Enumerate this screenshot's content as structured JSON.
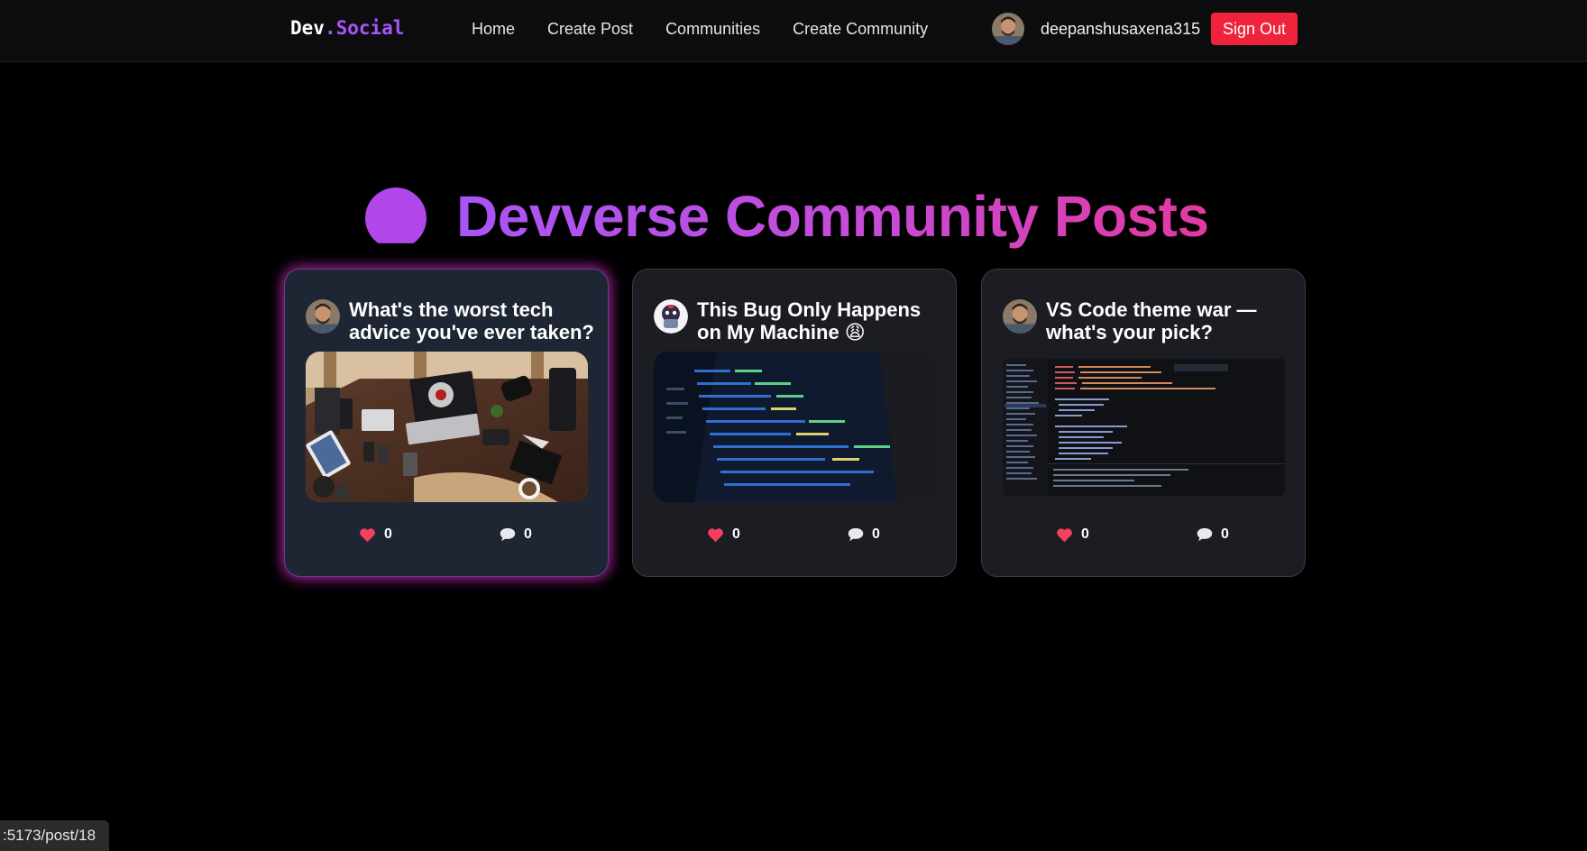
{
  "navbar": {
    "brand_part1": "Dev",
    "brand_part2": ".Social",
    "links": [
      "Home",
      "Create Post",
      "Communities",
      "Create Community"
    ],
    "username": "deepanshusaxena315",
    "signout_label": "Sign Out"
  },
  "heading": {
    "title": "Devverse Community Posts"
  },
  "posts": [
    {
      "title": "What's the worst tech advice you've ever taken?",
      "likes": "0",
      "comments": "0",
      "image": "desk-photo"
    },
    {
      "title": "This Bug Only Happens on My Machine 😩",
      "likes": "0",
      "comments": "0",
      "image": "code-screen-photo"
    },
    {
      "title": "VS Code theme war — what's your pick?",
      "likes": "0",
      "comments": "0",
      "image": "vscode-screenshot"
    }
  ],
  "icons": {
    "like": "heart-icon",
    "comment": "comment-bubble-icon"
  },
  "colors": {
    "brand_accent": "#a855f7",
    "signout": "#ef233c",
    "heading_gradient_start": "#a855f7",
    "heading_gradient_end": "#e3399f",
    "active_glow": "#c82dbe"
  },
  "status_bar": {
    "url": ":5173/post/18"
  }
}
